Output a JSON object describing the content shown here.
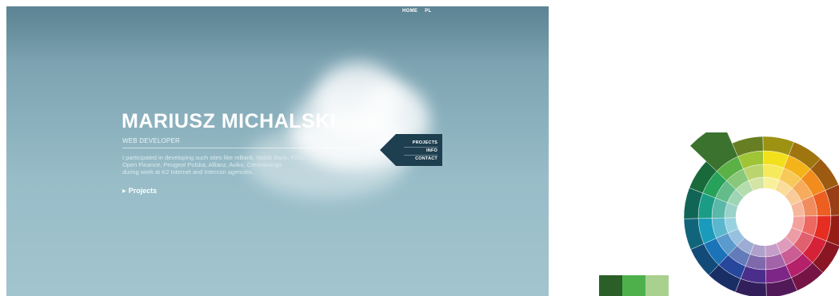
{
  "nav": {
    "items": [
      {
        "label": "HOME"
      },
      {
        "label": "PL"
      }
    ]
  },
  "hero": {
    "name": "MARIUSZ MICHALSKI",
    "role": "WEB DEVELOPER",
    "description_lines": [
      "I participated in developing such sites like mBank, Noble Bank, PZU,",
      "Open Finance, Peugeot Polska, Allianz, Aviko, Centralwings",
      "during work at K2 Internet and Intercon agencies."
    ],
    "link_label": "Projects"
  },
  "side_menu": {
    "items": [
      {
        "label": "PROJECTS"
      },
      {
        "label": "INFO"
      },
      {
        "label": "CONTACT"
      }
    ]
  },
  "colors": {
    "sky_top": "#6f96a6",
    "sky_bottom": "#a2c4ce",
    "menu_bg": "#1e3f50",
    "swatch_dark": "#2b5f28",
    "swatch_mid": "#4db04a",
    "swatch_light": "#a8d08e"
  },
  "swatches": [
    "#2b5f28",
    "#4db04a",
    "#a8d08e"
  ],
  "color_wheel": {
    "hues": [
      "#f2e01c",
      "#f4b419",
      "#f28c1c",
      "#ec5f21",
      "#e52d22",
      "#d52238",
      "#b5206a",
      "#7e2687",
      "#4b2e8c",
      "#26479c",
      "#1b73b8",
      "#1a9bbb",
      "#1a9c86",
      "#27a25b",
      "#5bb146",
      "#9fc435"
    ],
    "highlighted_hue": "#5bb146"
  }
}
